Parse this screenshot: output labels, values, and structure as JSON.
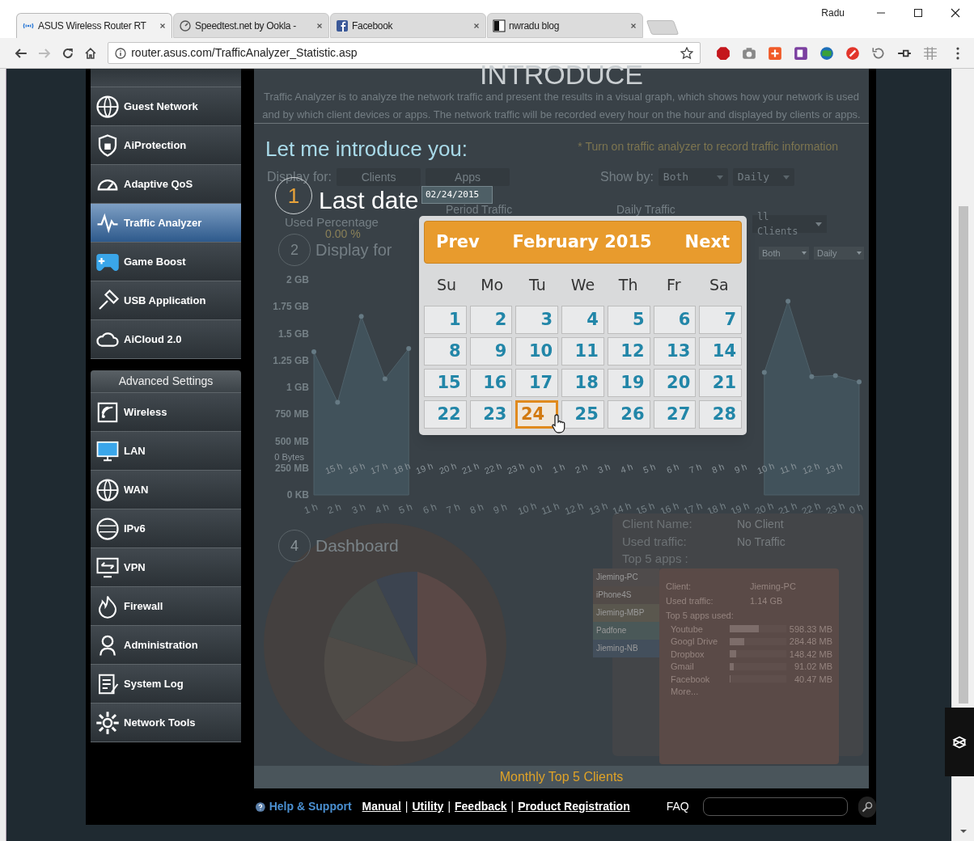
{
  "browser": {
    "tabs": [
      {
        "title": "ASUS Wireless Router RT",
        "selected": true
      },
      {
        "title": "Speedtest.net by Ookla -",
        "selected": false
      },
      {
        "title": "Facebook",
        "selected": false
      },
      {
        "title": "nwradu blog",
        "selected": false
      }
    ],
    "user": "Radu",
    "address": "router.asus.com/TrafficAnalyzer_Statistic.asp"
  },
  "sidebar": {
    "general_items": [
      {
        "label": "Guest Network",
        "selected": false
      },
      {
        "label": "AiProtection",
        "selected": false
      },
      {
        "label": "Adaptive QoS",
        "selected": false
      },
      {
        "label": "Traffic Analyzer",
        "selected": true
      },
      {
        "label": "Game Boost",
        "selected": false
      },
      {
        "label": "USB Application",
        "selected": false
      },
      {
        "label": "AiCloud 2.0",
        "selected": false
      }
    ],
    "advanced_heading": "Advanced Settings",
    "advanced_items": [
      {
        "label": "Wireless",
        "selected": false
      },
      {
        "label": "LAN",
        "selected": false
      },
      {
        "label": "WAN",
        "selected": false
      },
      {
        "label": "IPv6",
        "selected": false
      },
      {
        "label": "VPN",
        "selected": false
      },
      {
        "label": "Firewall",
        "selected": false
      },
      {
        "label": "Administration",
        "selected": false
      },
      {
        "label": "System Log",
        "selected": false
      },
      {
        "label": "Network Tools",
        "selected": false
      }
    ]
  },
  "background": {
    "heading": "INTRODUCE",
    "description": "Traffic Analyzer is to analyze the network traffic and present the results in a visual graph, which shows how your network is used and by which client devices or apps. The network traffic will be recorded every hour on the hour and displayed by clients or apps.",
    "notice": "* Turn on traffic analyzer to record traffic information",
    "display_for_label": "Display for:",
    "display_options": [
      "Clients",
      "Apps"
    ],
    "show_by_label": "Show by:",
    "show_by_values": [
      "Both",
      "Daily"
    ],
    "stats": {
      "period_traffic_label": "Period Traffic",
      "daily_traffic_label": "Daily Traffic",
      "used_percentage_label": "Used Percentage",
      "client_select": "ll Clients",
      "used_percentage": "0.00 %"
    },
    "chart": {
      "step": "2",
      "title": "Display for",
      "selects": [
        "Both",
        "Daily"
      ],
      "zero_label": "0 Bytes",
      "x_labels_second": [
        "15 h",
        "16 h",
        "17 h",
        "18 h",
        "19 h",
        "20 h",
        "21 h",
        "22 h",
        "23 h",
        "0 h",
        "1 h",
        "2 h",
        "3 h",
        "4 h",
        "5 h",
        "6 h",
        "7 h",
        "8 h",
        "9 h",
        "10 h",
        "11 h",
        "12 h",
        "13 h"
      ],
      "chart_data": {
        "type": "area",
        "categories": [
          "1 h",
          "2 h",
          "3 h",
          "4 h",
          "5 h",
          "6 h",
          "7 h",
          "8 h",
          "9 h",
          "10 h",
          "11 h",
          "12 h",
          "13 h",
          "14 h",
          "15 h",
          "16 h",
          "17 h",
          "18 h",
          "19 h",
          "20 h",
          "21 h",
          "22 h",
          "23 h",
          "0 h"
        ],
        "values": [
          1.33,
          0.86,
          1.66,
          1.08,
          1.36,
          null,
          null,
          null,
          null,
          null,
          null,
          null,
          null,
          null,
          null,
          null,
          null,
          null,
          null,
          1.14,
          1.8,
          1.1,
          1.11,
          1.05
        ],
        "ylim": [
          0,
          2
        ],
        "yticks": [
          {
            "value": 2,
            "label": "2 GB"
          },
          {
            "value": 1.75,
            "label": "1.75 GB"
          },
          {
            "value": 1.5,
            "label": "1.5 GB"
          },
          {
            "value": 1.25,
            "label": "1.25 GB"
          },
          {
            "value": 1,
            "label": "1 GB"
          }
        ]
      },
      "lower_axis_labels": [
        "750 MB",
        "500 MB",
        "250 MB",
        "0 KB"
      ]
    },
    "dashboard": {
      "step": "4",
      "title": "Dashboard",
      "summary": [
        {
          "label": "Client Name:",
          "value": "No Client"
        },
        {
          "label": "Used traffic:",
          "value": "No Traffic"
        }
      ],
      "summary_apps_label": "Top 5 apps :",
      "clients": [
        {
          "name": "Jieming-PC",
          "color": "#4f4b4b"
        },
        {
          "name": "iPhone4S",
          "color": "#524b48"
        },
        {
          "name": "Jieming-MBP",
          "color": "#5a574e"
        },
        {
          "name": "Padfone",
          "color": "#4a5858"
        },
        {
          "name": "Jieming-NB",
          "color": "#434f5c"
        }
      ],
      "detail": {
        "client_label": "Client:",
        "client": "Jieming-PC",
        "traffic_label": "Used traffic:",
        "traffic": "1.14 GB",
        "apps_label": "Top 5 apps used:",
        "apps": [
          {
            "name": "Youtube",
            "level": 0.52,
            "amount": "598.33 MB"
          },
          {
            "name": "Googl Drive",
            "level": 0.25,
            "amount": "284.48 MB"
          },
          {
            "name": "Dropbox",
            "level": 0.12,
            "amount": "148.42 MB"
          },
          {
            "name": "Gmail",
            "level": 0.07,
            "amount": "91.02 MB"
          },
          {
            "name": "Facebook",
            "level": 0.02,
            "amount": "40.47 MB"
          }
        ],
        "more": "More..."
      }
    },
    "banner": "Monthly Top 5 Clients"
  },
  "tour": {
    "intro": "Let me introduce you:",
    "step": "1",
    "label": "Last date",
    "date": "02/24/2015"
  },
  "calendar": {
    "prev": "Prev",
    "month": "February 2015",
    "next": "Next",
    "weekdays": [
      "Su",
      "Mo",
      "Tu",
      "We",
      "Th",
      "Fr",
      "Sa"
    ],
    "days": [
      {
        "day": "1",
        "selected": false
      },
      {
        "day": "2",
        "selected": false
      },
      {
        "day": "3",
        "selected": false
      },
      {
        "day": "4",
        "selected": false
      },
      {
        "day": "5",
        "selected": false
      },
      {
        "day": "6",
        "selected": false
      },
      {
        "day": "7",
        "selected": false
      },
      {
        "day": "8",
        "selected": false
      },
      {
        "day": "9",
        "selected": false
      },
      {
        "day": "10",
        "selected": false
      },
      {
        "day": "11",
        "selected": false
      },
      {
        "day": "12",
        "selected": false
      },
      {
        "day": "13",
        "selected": false
      },
      {
        "day": "14",
        "selected": false
      },
      {
        "day": "15",
        "selected": false
      },
      {
        "day": "16",
        "selected": false
      },
      {
        "day": "17",
        "selected": false
      },
      {
        "day": "18",
        "selected": false
      },
      {
        "day": "19",
        "selected": false
      },
      {
        "day": "20",
        "selected": false
      },
      {
        "day": "21",
        "selected": false
      },
      {
        "day": "22",
        "selected": false
      },
      {
        "day": "23",
        "selected": false
      },
      {
        "day": "24",
        "selected": true
      },
      {
        "day": "25",
        "selected": false
      },
      {
        "day": "26",
        "selected": false
      },
      {
        "day": "27",
        "selected": false
      },
      {
        "day": "28",
        "selected": false
      }
    ]
  },
  "footer": {
    "help": "Help & Support",
    "links": [
      "Manual",
      "Utility",
      "Feedback",
      "Product Registration"
    ],
    "separators": [
      "|",
      "|",
      "|"
    ],
    "faq": "FAQ"
  }
}
